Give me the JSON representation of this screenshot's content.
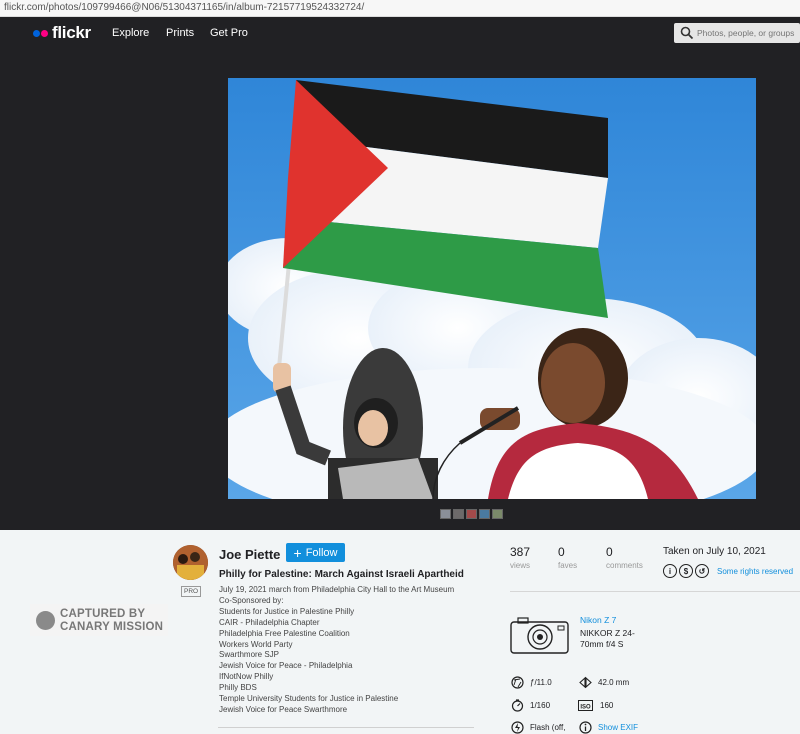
{
  "browser": {
    "url": "flickr.com/photos/109799466@N06/51304371165/in/album-72157719524332724/"
  },
  "nav": {
    "logo": "flickr",
    "links": [
      "Explore",
      "Prints",
      "Get Pro"
    ],
    "search_placeholder": "Photos, people, or groups"
  },
  "photo": {
    "thumbnail_count": 5
  },
  "owner": {
    "name": "Joe Piette",
    "badge": "PRO",
    "follow_label": "Follow"
  },
  "watermark": {
    "line1": "CAPTURED BY",
    "line2": "CANARY MISSION"
  },
  "photo_info": {
    "title": "Philly for Palestine: March Against Israeli Apartheid",
    "description": [
      "July 19, 2021 march from Philadelphia City Hall to the Art Museum",
      "Co-Sponsored by:",
      "Students for Justice in Palestine Philly",
      "CAIR - Philadelphia Chapter",
      "Philadelphia Free Palestine Coalition",
      "Workers World Party",
      "Swarthmore SJP",
      "Jewish Voice for Peace - Philadelphia",
      "IfNotNow Philly",
      "Philly BDS",
      "Temple University Students for Justice in Palestine",
      "Jewish Voice for Peace Swarthmore"
    ]
  },
  "stats": {
    "views": {
      "value": "387",
      "label": "views"
    },
    "faves": {
      "value": "0",
      "label": "faves"
    },
    "comments": {
      "value": "0",
      "label": "comments"
    }
  },
  "taken": "Taken on July 10, 2021",
  "license": "Some rights reserved",
  "camera": {
    "model": "Nikon Z 7",
    "lens": "NIKKOR Z 24-70mm f/4 S",
    "aperture": "ƒ/11.0",
    "focal_length": "42.0 mm",
    "shutter": "1/160",
    "iso": "160",
    "flash": "Flash (off,",
    "show_exif": "Show EXIF"
  },
  "colors": {
    "accent": "#128fdc",
    "nav_bg": "#212124",
    "flickr_blue": "#0063dc",
    "flickr_pink": "#ff0084"
  }
}
